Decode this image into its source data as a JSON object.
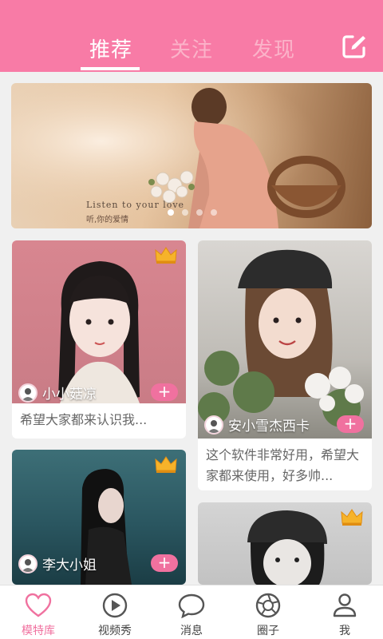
{
  "header": {
    "tabs": [
      {
        "label": "推荐",
        "active": true
      },
      {
        "label": "关注",
        "active": false
      },
      {
        "label": "发现",
        "active": false
      }
    ],
    "edit_icon": "edit-icon"
  },
  "banner": {
    "image_text": "Listen to your love",
    "image_subtext": "听,你的爱情",
    "slide_count": 4,
    "active_slide": 1
  },
  "cards": [
    {
      "author": "小小菇凉",
      "description": "希望大家都来认识我...",
      "has_crown": true
    },
    {
      "author": "安小雪杰西卡",
      "description": "这个软件非常好用，希望大家都来使用，好多帅...",
      "has_crown": false
    },
    {
      "author": "李大小姐",
      "description": "",
      "has_crown": true
    },
    {
      "author": "",
      "description": "",
      "has_crown": true
    }
  ],
  "bottom_nav": [
    {
      "label": "模特库",
      "icon": "heart-icon",
      "active": true
    },
    {
      "label": "视频秀",
      "icon": "play-icon",
      "active": false
    },
    {
      "label": "消息",
      "icon": "chat-bubble-icon",
      "active": false
    },
    {
      "label": "圈子",
      "icon": "aperture-icon",
      "active": false
    },
    {
      "label": "我",
      "icon": "person-icon",
      "active": false
    }
  ],
  "colors": {
    "brand_pink": "#f87ba6",
    "add_button": "#f0719f",
    "active_nav": "#f0719f"
  }
}
